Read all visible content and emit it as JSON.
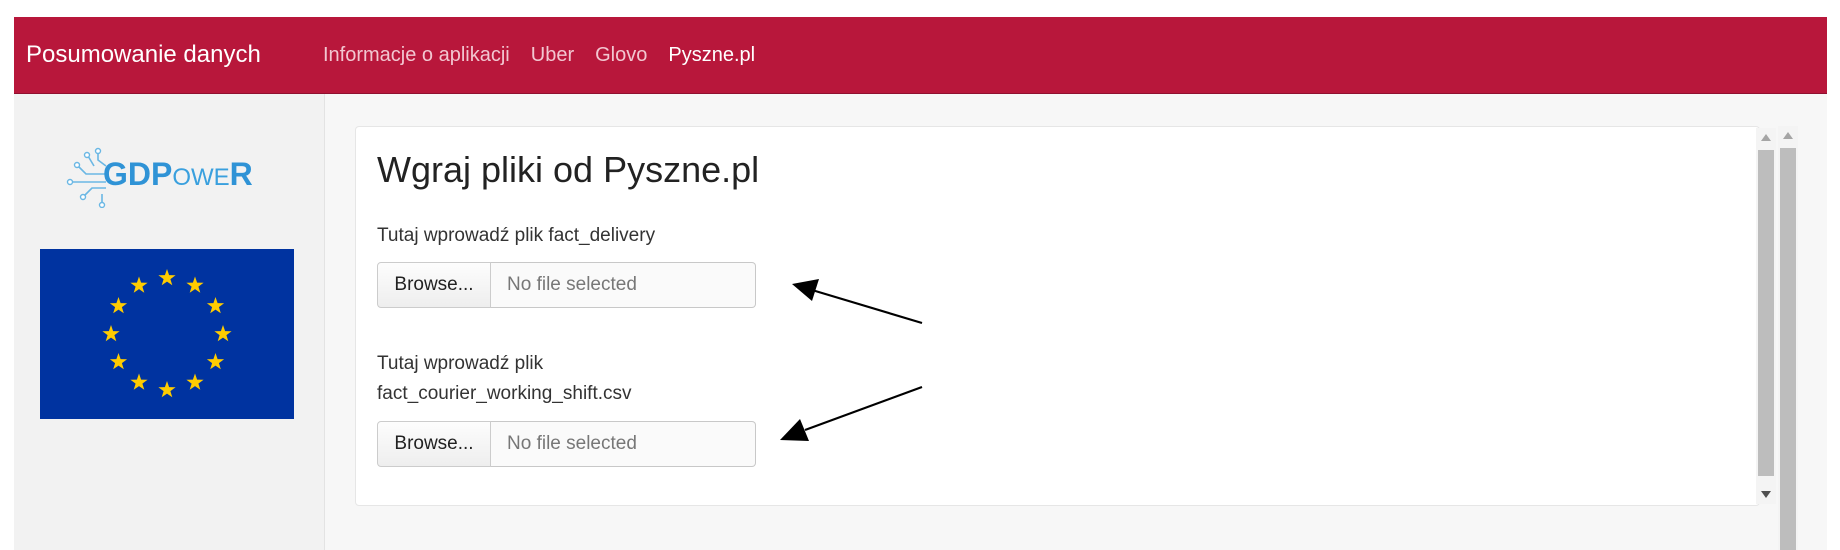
{
  "navbar": {
    "brand": "Posumowanie danych",
    "links": [
      {
        "label": "Informacje o aplikacji",
        "active": false
      },
      {
        "label": "Uber",
        "active": false
      },
      {
        "label": "Glovo",
        "active": false
      },
      {
        "label": "Pyszne.pl",
        "active": true
      }
    ],
    "color": "#b8173b"
  },
  "sidebar": {
    "logo": {
      "icon": "circuit-logo-icon",
      "text_big": "GDP",
      "text_p": "P",
      "text_rest": "OWE",
      "text_end": "R"
    },
    "flag": {
      "icon": "eu-flag-icon",
      "blue": "#0033a0",
      "star_color": "#ffcc00"
    }
  },
  "main": {
    "title": "Wgraj pliki od Pyszne.pl",
    "uploads": [
      {
        "label_lines": [
          "Tutaj wprowadź plik fact_delivery"
        ],
        "button": "Browse...",
        "placeholder": "No file selected"
      },
      {
        "label_lines": [
          "Tutaj wprowadź plik",
          "fact_courier_working_shift.csv"
        ],
        "button": "Browse...",
        "placeholder": "No file selected"
      }
    ]
  },
  "annotations": {
    "arrow_color": "#000000",
    "count": 2
  }
}
